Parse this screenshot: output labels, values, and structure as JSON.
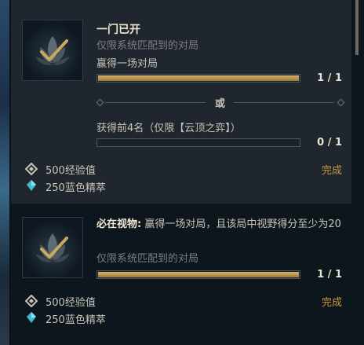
{
  "card1": {
    "title": "一门已开",
    "subtitle": "仅限系统匹配到的对局",
    "objective1": {
      "label": "赢得一场对局",
      "count": "1 / 1",
      "progress": 1.0
    },
    "separator": "或",
    "objective2": {
      "label": "获得前4名（仅限【云顶之弈】）",
      "count": "0 / 1",
      "progress": 0.0
    },
    "rewards": [
      {
        "icon": "xp-icon",
        "label": "500经验值"
      },
      {
        "icon": "blue-essence-icon",
        "label": "250蓝色精萃"
      }
    ],
    "status": "完成"
  },
  "card2": {
    "title_bold": "必在视物:",
    "title_rest": " 赢得一场对局，且该局中视野得分至少为20",
    "subtitle": "仅限系统匹配到的对局",
    "objective1": {
      "count": "1 / 1",
      "progress": 1.0
    },
    "rewards": [
      {
        "icon": "xp-icon",
        "label": "500经验值"
      },
      {
        "icon": "blue-essence-icon",
        "label": "250蓝色精萃"
      }
    ],
    "status": "完成"
  },
  "colors": {
    "gold": "#c89b3c",
    "bar": "#c9a95e",
    "essence": "#3fb8d6"
  }
}
